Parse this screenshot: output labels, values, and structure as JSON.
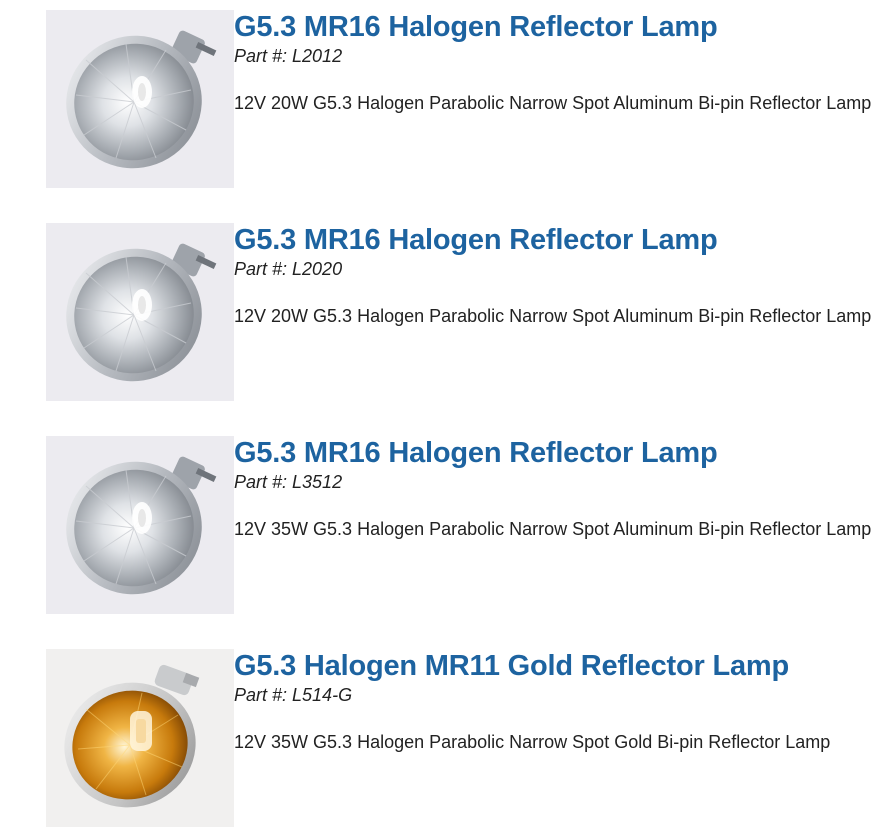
{
  "products": [
    {
      "title": "G5.3 MR16 Halogen Reflector Lamp",
      "part_label": "Part #: L2012",
      "description": "12V 20W G5.3 Halogen Parabolic Narrow Spot Aluminum Bi-pin Reflector Lamp",
      "image": "mr16-silver-reflector-lamp"
    },
    {
      "title": "G5.3 MR16 Halogen Reflector Lamp",
      "part_label": "Part #: L2020",
      "description": "12V 20W G5.3 Halogen Parabolic Narrow Spot Aluminum Bi-pin Reflector Lamp",
      "image": "mr16-silver-reflector-lamp"
    },
    {
      "title": "G5.3 MR16 Halogen Reflector Lamp",
      "part_label": "Part #: L3512",
      "description": "12V 35W G5.3 Halogen Parabolic Narrow Spot Aluminum Bi-pin Reflector Lamp",
      "image": "mr16-silver-reflector-lamp"
    },
    {
      "title": "G5.3 Halogen MR11 Gold Reflector Lamp",
      "part_label": "Part #: L514-G",
      "description": "12V 35W G5.3 Halogen Parabolic Narrow Spot Gold Bi-pin Reflector Lamp",
      "image": "mr11-gold-reflector-lamp"
    }
  ],
  "colors": {
    "title_link": "#1d63a0",
    "body_text": "#222222",
    "image_background": "#ecebf0"
  }
}
